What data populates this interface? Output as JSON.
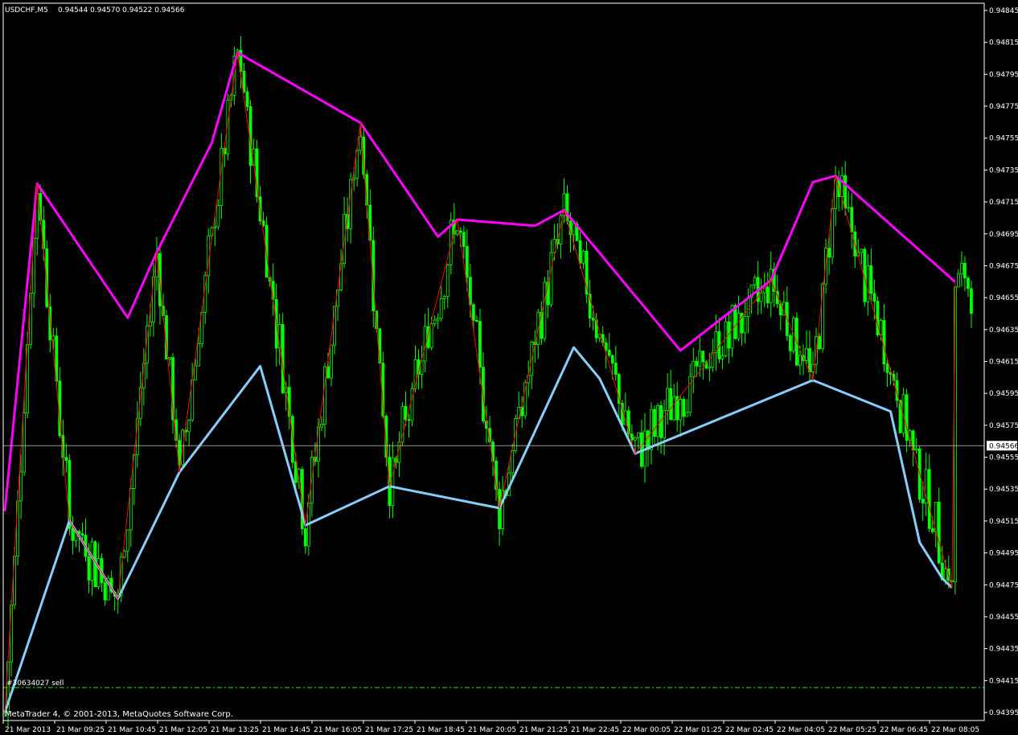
{
  "header": {
    "symbol": "USDCHF,M5",
    "ohlc": "0.94544 0.94570 0.94522 0.94566"
  },
  "order_label": "#30634027 sell",
  "copyright": "MetaTrader 4, © 2001-2013, MetaQuotes Software Corp.",
  "current_price_label": "0.94566",
  "colors": {
    "background": "#000000",
    "frame": "#ffffff",
    "candles": "#00ff00",
    "zigzag": "#ff0000",
    "upper_envelope": "#ff00ff",
    "lower_envelope": "#87cefa",
    "bid_line": "#c0c0c0",
    "order_line": "#00ff00"
  },
  "chart_data": {
    "type": "line",
    "title": "USDCHF,M5",
    "ylim": [
      0.94385,
      0.94845
    ],
    "y_ticks": [
      "0.94845",
      "0.94815",
      "0.94795",
      "0.94775",
      "0.94755",
      "0.94735",
      "0.94715",
      "0.94695",
      "0.94675",
      "0.94655",
      "0.94635",
      "0.94615",
      "0.94595",
      "0.94575",
      "0.94555",
      "0.94535",
      "0.94515",
      "0.94495",
      "0.94475",
      "0.94455",
      "0.94435",
      "0.94415",
      "0.94395"
    ],
    "x_ticks": [
      "21 Mar 2013",
      "21 Mar 09:25",
      "21 Mar 10:45",
      "21 Mar 12:05",
      "21 Mar 13:25",
      "21 Mar 14:45",
      "21 Mar 16:05",
      "21 Mar 17:25",
      "21 Mar 18:45",
      "21 Mar 20:05",
      "21 Mar 21:25",
      "21 Mar 22:45",
      "22 Mar 00:05",
      "22 Mar 01:25",
      "22 Mar 02:45",
      "22 Mar 04:05",
      "22 Mar 05:25",
      "22 Mar 06:45",
      "22 Mar 08:05"
    ],
    "bar_count": 300,
    "current_bid": 0.94566,
    "order_price": 0.94411,
    "series": [
      {
        "type": "line",
        "points": [
          [
            0,
            0.94524
          ],
          [
            10,
            0.94734
          ],
          [
            38,
            0.94648
          ],
          [
            47,
            0.9469
          ],
          [
            64,
            0.9476
          ],
          [
            72,
            0.94818
          ],
          [
            110,
            0.94773
          ],
          [
            134,
            0.947
          ],
          [
            140,
            0.94711
          ],
          [
            164,
            0.94707
          ],
          [
            173,
            0.94717
          ],
          [
            209,
            0.94627
          ],
          [
            237,
            0.94672
          ],
          [
            250,
            0.94735
          ],
          [
            257,
            0.94739
          ],
          [
            294,
            0.94671
          ]
        ]
      },
      {
        "type": "line",
        "points": [
          [
            0,
            0.94395
          ],
          [
            20,
            0.94518
          ],
          [
            35,
            0.94468
          ],
          [
            54,
            0.94549
          ],
          [
            79,
            0.94617
          ],
          [
            93,
            0.94515
          ],
          [
            119,
            0.9454
          ],
          [
            153,
            0.94526
          ],
          [
            176,
            0.94629
          ],
          [
            184,
            0.94609
          ],
          [
            195,
            0.94561
          ],
          [
            250,
            0.94608
          ],
          [
            274,
            0.94588
          ],
          [
            283,
            0.94504
          ],
          [
            290,
            0.94481
          ],
          [
            293,
            0.94475
          ]
        ]
      },
      {
        "type": "line",
        "points": [
          [
            0,
            0.94395
          ],
          [
            10,
            0.94734
          ],
          [
            20,
            0.94518
          ],
          [
            35,
            0.94468
          ],
          [
            47,
            0.9469
          ],
          [
            54,
            0.94549
          ],
          [
            72,
            0.94818
          ],
          [
            93,
            0.94515
          ],
          [
            110,
            0.94773
          ],
          [
            119,
            0.9454
          ],
          [
            140,
            0.94711
          ],
          [
            153,
            0.94526
          ],
          [
            173,
            0.94717
          ],
          [
            195,
            0.94561
          ],
          [
            237,
            0.94672
          ],
          [
            250,
            0.94608
          ],
          [
            257,
            0.94739
          ],
          [
            293,
            0.94475
          ],
          [
            294,
            0.94671
          ]
        ]
      }
    ]
  }
}
